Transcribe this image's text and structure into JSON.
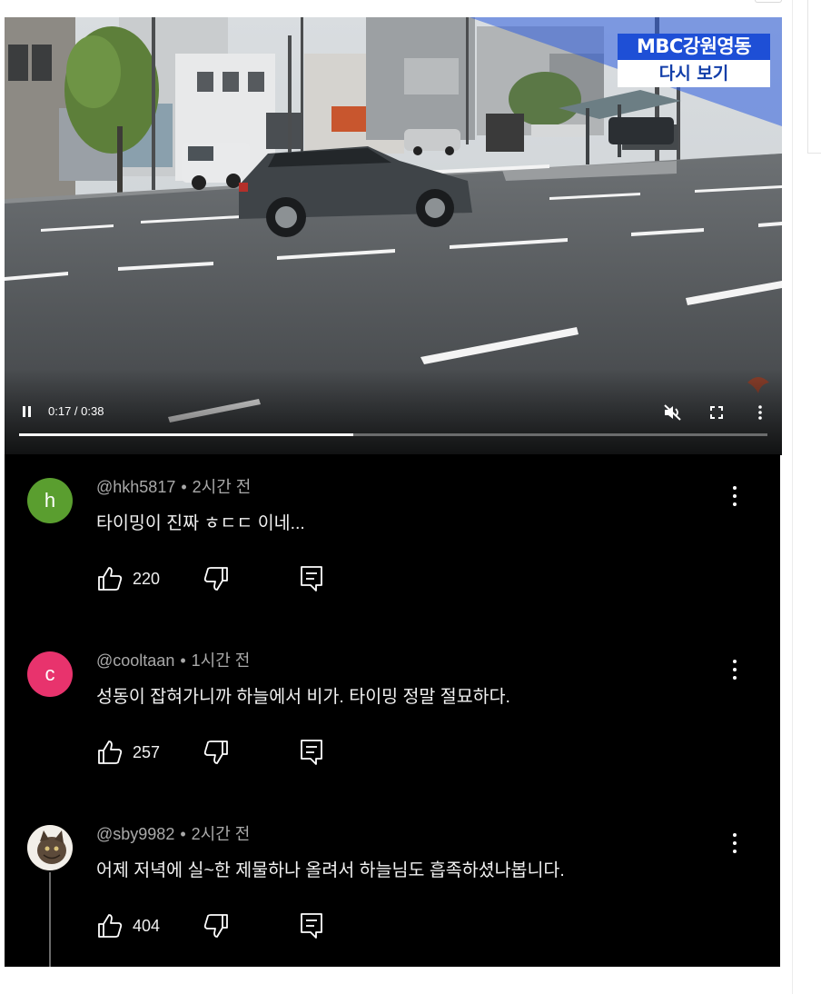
{
  "video": {
    "watermark_line1": "MBC강원영동",
    "watermark_line2": "다시 보기",
    "time_current": "0:17",
    "time_total": "0:38",
    "progress_fraction": 0.447,
    "muted": true
  },
  "comments": [
    {
      "avatar_letter": "h",
      "avatar_color": "#5a9e2f",
      "author": "@hkh5817",
      "time": "2시간 전",
      "text": "타이밍이 진짜 ㅎㄷㄷ 이네...",
      "likes": "220"
    },
    {
      "avatar_letter": "c",
      "avatar_color": "#e8336d",
      "author": "@cooltaan",
      "time": "1시간 전",
      "text": "성동이 잡혀가니까 하늘에서 비가. 타이밍 정말 절묘하다.",
      "likes": "257"
    },
    {
      "avatar_letter": "",
      "avatar_color": "#6b5a48",
      "author": "@sby9982",
      "time": "2시간 전",
      "text": "어제 저녁에 실~한 제물하나 올려서 하늘님도 흡족하셨나봅니다.",
      "likes": "404"
    }
  ],
  "icons": {
    "pause": "pause-icon",
    "mute": "mute-icon",
    "fullscreen": "fullscreen-icon",
    "more": "more-vert-icon",
    "like": "thumb-up-icon",
    "dislike": "thumb-down-icon",
    "reply": "reply-icon"
  }
}
